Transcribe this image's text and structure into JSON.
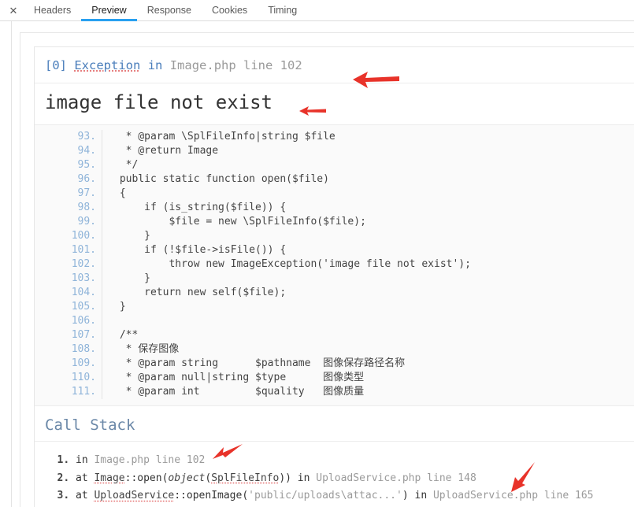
{
  "tabbar": {
    "close_label": "✕",
    "tabs": [
      {
        "label": "Headers",
        "active": false
      },
      {
        "label": "Preview",
        "active": true
      },
      {
        "label": "Response",
        "active": false
      },
      {
        "label": "Cookies",
        "active": false
      },
      {
        "label": "Timing",
        "active": false
      }
    ],
    "active_underline_color": "#28a0f0"
  },
  "exception": {
    "index": "[0]",
    "class": "Exception",
    "in": "in",
    "location": "Image.php line 102",
    "message": "image file not exist"
  },
  "code": {
    "lines": [
      {
        "no": "93.",
        "text": "  * @param \\SplFileInfo|string $file"
      },
      {
        "no": "94.",
        "text": "  * @return Image"
      },
      {
        "no": "95.",
        "text": "  */"
      },
      {
        "no": "96.",
        "text": " public static function open($file)"
      },
      {
        "no": "97.",
        "text": " {"
      },
      {
        "no": "98.",
        "text": "     if (is_string($file)) {"
      },
      {
        "no": "99.",
        "text": "         $file = new \\SplFileInfo($file);"
      },
      {
        "no": "100.",
        "text": "     }"
      },
      {
        "no": "101.",
        "text": "     if (!$file->isFile()) {"
      },
      {
        "no": "102.",
        "text": "         throw new ImageException('image file not exist');"
      },
      {
        "no": "103.",
        "text": "     }"
      },
      {
        "no": "104.",
        "text": "     return new self($file);"
      },
      {
        "no": "105.",
        "text": " }"
      },
      {
        "no": "106.",
        "text": ""
      },
      {
        "no": "107.",
        "text": " /**"
      },
      {
        "no": "108.",
        "text": "  * 保存图像"
      },
      {
        "no": "109.",
        "text": "  * @param string      $pathname  图像保存路径名称"
      },
      {
        "no": "110.",
        "text": "  * @param null|string $type      图像类型"
      },
      {
        "no": "111.",
        "text": "  * @param int         $quality   图像质量"
      }
    ]
  },
  "call_stack": {
    "title": "Call Stack",
    "items": [
      {
        "kw": "in",
        "cls": "",
        "sep": "",
        "method": "",
        "args": "",
        "in": "",
        "file": "Image.php line 102",
        "plain": "Image.php line 102"
      },
      {
        "kw": "at",
        "cls": "Image",
        "sep": "::",
        "method": "open(",
        "arg_italic": "object",
        "arg_open": "(",
        "arg_dotted": "SplFileInfo",
        "arg_close": "))",
        "in": "in",
        "file": "UploadService.php line 148"
      },
      {
        "kw": "at",
        "cls": "UploadService",
        "sep": "::",
        "method": "openImage(",
        "arg_text": "'public/uploads\\attac...'",
        "arg_close": ")",
        "in": "in",
        "file": "UploadService.php line 165"
      }
    ]
  },
  "annotations": {
    "arrow_color": "#e8332a",
    "arrows": [
      {
        "name": "arrow-exception-header"
      },
      {
        "name": "arrow-exception-message"
      },
      {
        "name": "arrow-callstack-first"
      },
      {
        "name": "arrow-callstack-third"
      }
    ]
  }
}
